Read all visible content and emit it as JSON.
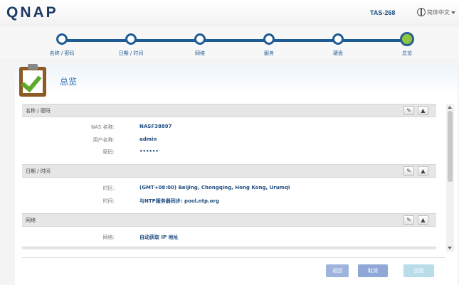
{
  "header": {
    "logo": "QNAP",
    "model": "TAS-268",
    "language": "简体中文"
  },
  "wizard": {
    "steps": [
      {
        "label": "名称 / 密码"
      },
      {
        "label": "日期 / 时间"
      },
      {
        "label": "网络"
      },
      {
        "label": "服务"
      },
      {
        "label": "硬盘"
      },
      {
        "label": "总览"
      }
    ],
    "active_step": 6
  },
  "summary": {
    "title": "总览",
    "sections": [
      {
        "title": "名称 / 密码",
        "rows": [
          {
            "label": "NAS 名称:",
            "value": "NASF38897"
          },
          {
            "label": "用户名称:",
            "value": "admin"
          },
          {
            "label": "密码:",
            "value": "••••••"
          }
        ]
      },
      {
        "title": "日期 / 时间",
        "rows": [
          {
            "label": "时区:",
            "value": "(GMT+08:00) Beijing, Chongqing, Hong Kong, Urumqi"
          },
          {
            "label": "时间:",
            "value": "与NTP服务器同步: pool.ntp.org"
          }
        ]
      },
      {
        "title": "网络",
        "rows": [
          {
            "label": "网络:",
            "value": "自动获取 IP 地址"
          }
        ]
      }
    ],
    "edit_glyph": "✎",
    "collapse_glyph": "▲"
  },
  "footer": {
    "back": "返回",
    "cancel": "取消",
    "apply": "应用"
  }
}
